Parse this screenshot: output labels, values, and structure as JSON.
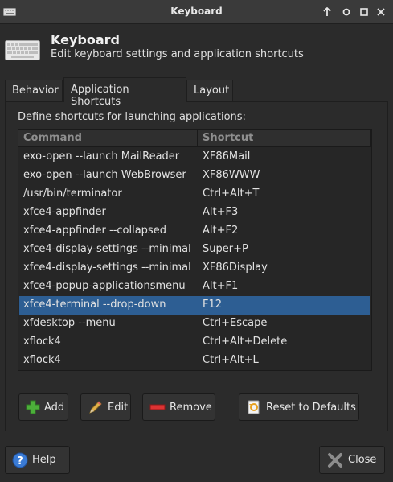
{
  "window": {
    "title": "Keyboard"
  },
  "header": {
    "title": "Keyboard",
    "subtitle": "Edit keyboard settings and application shortcuts"
  },
  "tabs": [
    {
      "label": "Behavior",
      "active": false
    },
    {
      "label": "Application Shortcuts",
      "active": true
    },
    {
      "label": "Layout",
      "active": false
    }
  ],
  "shortcuts": {
    "intro": "Define shortcuts for launching applications:",
    "columns": [
      "Command",
      "Shortcut"
    ],
    "rows": [
      {
        "command": "exo-open --launch MailReader",
        "shortcut": "XF86Mail"
      },
      {
        "command": "exo-open --launch WebBrowser",
        "shortcut": "XF86WWW"
      },
      {
        "command": "/usr/bin/terminator",
        "shortcut": "Ctrl+Alt+T"
      },
      {
        "command": "xfce4-appfinder",
        "shortcut": "Alt+F3"
      },
      {
        "command": "xfce4-appfinder --collapsed",
        "shortcut": "Alt+F2"
      },
      {
        "command": "xfce4-display-settings --minimal",
        "shortcut": "Super+P"
      },
      {
        "command": "xfce4-display-settings --minimal",
        "shortcut": "XF86Display"
      },
      {
        "command": "xfce4-popup-applicationsmenu",
        "shortcut": "Alt+F1"
      },
      {
        "command": "xfce4-terminal --drop-down",
        "shortcut": "F12",
        "selected": true
      },
      {
        "command": "xfdesktop --menu",
        "shortcut": "Ctrl+Escape"
      },
      {
        "command": "xflock4",
        "shortcut": "Ctrl+Alt+Delete"
      },
      {
        "command": "xflock4",
        "shortcut": "Ctrl+Alt+L"
      }
    ]
  },
  "buttons": {
    "add": "Add",
    "edit": "Edit",
    "remove": "Remove",
    "reset": "Reset to Defaults",
    "help": "Help",
    "close": "Close"
  },
  "colors": {
    "selection": "#2d5e93",
    "background": "#2b2b2b"
  }
}
